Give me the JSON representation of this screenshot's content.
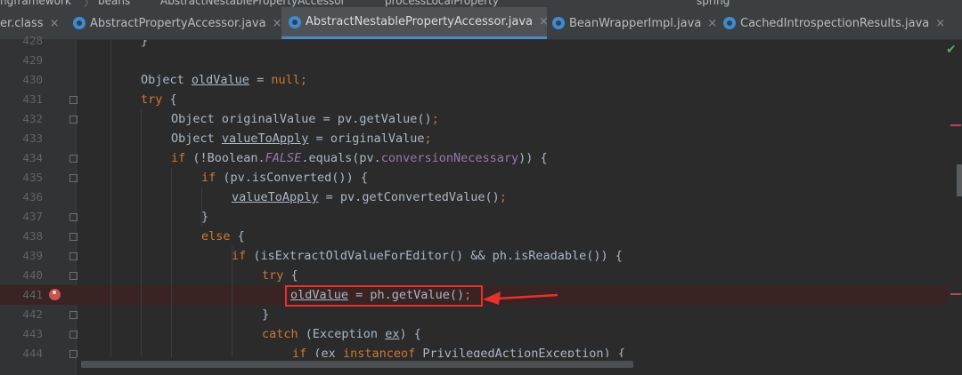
{
  "breadcrumb": {
    "items": [
      "ngframework",
      "beans",
      "AbstractNestablePropertyAccessor",
      "processLocalProperty"
    ],
    "separator": "〉"
  },
  "run_config": "spring",
  "tabs": [
    {
      "label": "er.class",
      "active": false
    },
    {
      "label": "AbstractPropertyAccessor.java",
      "active": false
    },
    {
      "label": "AbstractNestablePropertyAccessor.java",
      "active": true
    },
    {
      "label": "BeanWrapperImpl.java",
      "active": false
    },
    {
      "label": "CachedIntrospectionResults.java",
      "active": false
    }
  ],
  "tab_close": "×",
  "inspection_status": "✔",
  "code_lines": [
    {
      "num": "428",
      "text": "}"
    },
    {
      "num": "429",
      "text": ""
    },
    {
      "num": "430",
      "text": "Object oldValue = null;"
    },
    {
      "num": "431",
      "text": "try {"
    },
    {
      "num": "432",
      "text": "Object originalValue = pv.getValue();"
    },
    {
      "num": "433",
      "text": "Object valueToApply = originalValue;"
    },
    {
      "num": "434",
      "text": "if (!Boolean.FALSE.equals(pv.conversionNecessary)) {"
    },
    {
      "num": "435",
      "text": "if (pv.isConverted()) {"
    },
    {
      "num": "436",
      "text": "valueToApply = pv.getConvertedValue();"
    },
    {
      "num": "437",
      "text": "}"
    },
    {
      "num": "438",
      "text": "else {"
    },
    {
      "num": "439",
      "text": "if (isExtractOldValueForEditor() && ph.isReadable()) {"
    },
    {
      "num": "440",
      "text": "try {"
    },
    {
      "num": "441",
      "text": "oldValue = ph.getValue();"
    },
    {
      "num": "442",
      "text": "}"
    },
    {
      "num": "443",
      "text": "catch (Exception ex) {"
    },
    {
      "num": "444",
      "text": "if (ex instanceof PrivilegedActionException) {"
    }
  ],
  "breakpoint_line": "441",
  "colors": {
    "background": "#2b2b2b",
    "keyword": "#cc7832",
    "field": "#9876aa",
    "text": "#a9b7c6",
    "breakpoint": "#c75450",
    "annotation_red": "#e5312f"
  }
}
